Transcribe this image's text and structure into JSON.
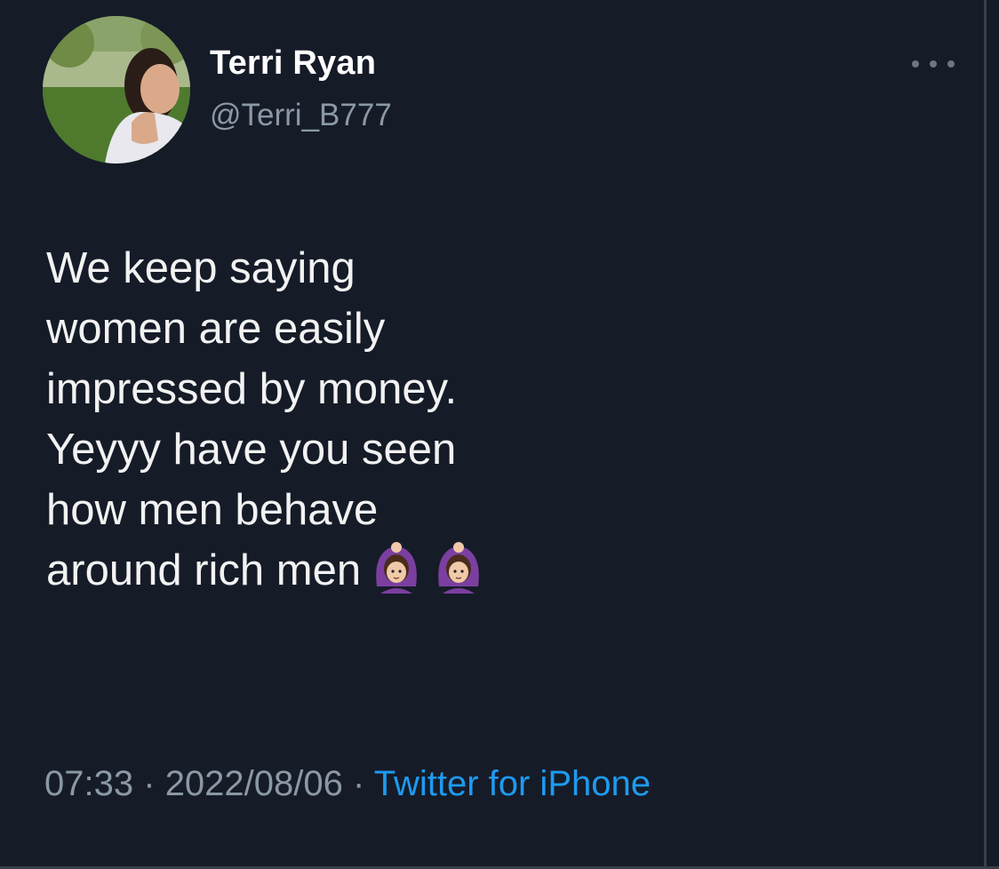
{
  "tweet": {
    "author": {
      "display_name": "Terri Ryan",
      "handle": "@Terri_B777",
      "avatar_icon": "profile-photo"
    },
    "more_icon": "more-dots-icon",
    "text_lines": [
      "We keep saying",
      "women are easily",
      "impressed by money.",
      "Yeyyy have you seen",
      "how men behave",
      "around rich men"
    ],
    "emojis": [
      "person-gesturing-ok-emoji",
      "person-gesturing-ok-emoji"
    ],
    "time": "07:33",
    "separator": "·",
    "date": "2022/08/06",
    "source": "Twitter for iPhone"
  },
  "colors": {
    "background": "#161b28",
    "primary_text": "#f2f2f2",
    "secondary_text": "#8b98a5",
    "link": "#1d9bf0"
  }
}
